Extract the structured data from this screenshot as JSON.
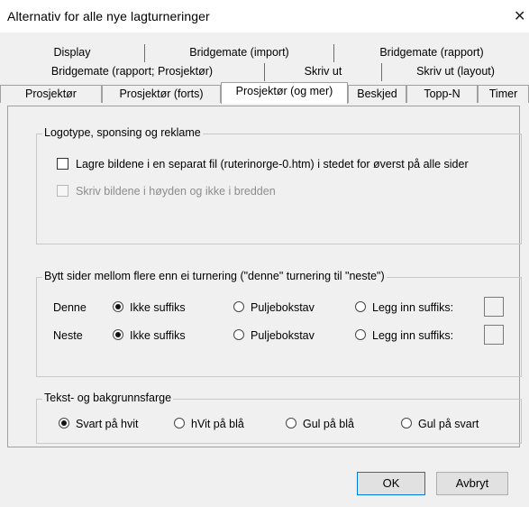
{
  "window": {
    "title": "Alternativ for alle nye lagturneringer",
    "close_glyph": "✕"
  },
  "tabs": {
    "row1": [
      "Display",
      "Bridgemate (import)",
      "Bridgemate (rapport)"
    ],
    "row2": [
      "Bridgemate (rapport; Prosjektør)",
      "Skriv ut",
      "Skriv ut (layout)"
    ],
    "row3": [
      "Prosjektør",
      "Prosjektør (forts)",
      "Prosjektør (og mer)",
      "Beskjed",
      "Topp-N",
      "Timer"
    ],
    "active": "Prosjektør (og mer)"
  },
  "logo_group": {
    "label": "Logotype, sponsing og reklame",
    "save_separate": {
      "label": "Lagre bildene i en separat fil (ruterinorge-0.htm) i stedet for øverst på alle sider",
      "checked": false
    },
    "vertical": {
      "label": "Skriv bildene i høyden og ikke i bredden",
      "checked": false,
      "enabled": false
    }
  },
  "switch_group": {
    "label": "Bytt sider mellom flere enn ei turnering (\"denne\" turnering til \"neste\")",
    "denne": {
      "label": "Denne",
      "options": [
        "Ikke suffiks",
        "Puljebokstav",
        "Legg inn suffiks:"
      ],
      "selected": "Ikke suffiks",
      "suffix_value": ""
    },
    "neste": {
      "label": "Neste",
      "options": [
        "Ikke suffiks",
        "Puljebokstav",
        "Legg inn suffiks:"
      ],
      "selected": "Ikke suffiks",
      "suffix_value": ""
    }
  },
  "color_group": {
    "label": "Tekst- og bakgrunnsfarge",
    "options": [
      "Svart på hvit",
      "hVit på blå",
      "Gul på blå",
      "Gul på svart"
    ],
    "selected": "Svart på hvit"
  },
  "buttons": {
    "ok": "OK",
    "cancel": "Avbryt"
  },
  "colors": {
    "dialog_bg": "#f0f0f0",
    "page_border": "#a0a0a0",
    "default_button_border": "#0078d7",
    "disabled_text": "#8c8c8c"
  }
}
